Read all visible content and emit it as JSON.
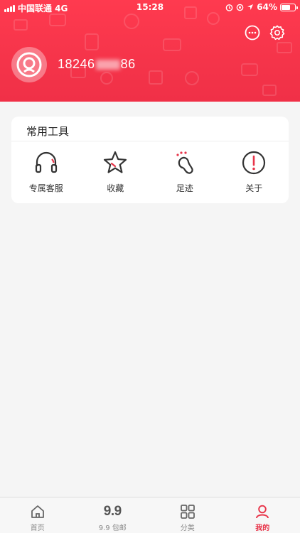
{
  "status_bar": {
    "carrier": "中国联通 4G",
    "time": "15:28",
    "battery": "64%"
  },
  "profile": {
    "phone_prefix": "18246",
    "phone_suffix": "86"
  },
  "tools_card": {
    "title": "常用工具",
    "items": [
      {
        "label": "专属客服",
        "icon": "headphones-icon"
      },
      {
        "label": "收藏",
        "icon": "star-icon"
      },
      {
        "label": "足迹",
        "icon": "footprint-icon"
      },
      {
        "label": "关于",
        "icon": "info-icon"
      }
    ]
  },
  "tabbar": {
    "items": [
      {
        "label": "首页",
        "icon": "home-icon"
      },
      {
        "label": "9.9 包邮",
        "icon": "9.9"
      },
      {
        "label": "分类",
        "icon": "grid-icon"
      },
      {
        "label": "我的",
        "icon": "person-icon",
        "active": true
      }
    ]
  },
  "colors": {
    "brand_red": "#f5344a",
    "accent_red": "#e8354a"
  }
}
